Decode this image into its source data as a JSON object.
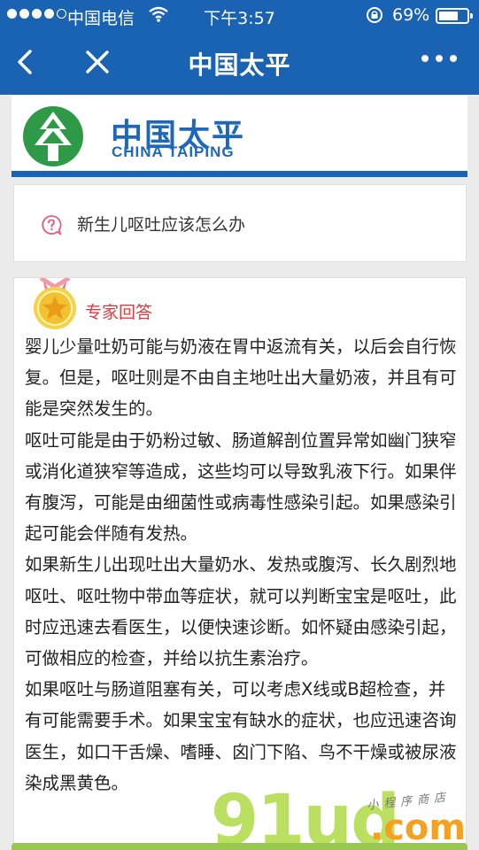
{
  "status_bar": {
    "carrier": "中国电信",
    "time": "下午3:57",
    "battery_percent": "69%",
    "battery_level": 0.69
  },
  "nav": {
    "title": "中国太平",
    "back_icon": "chevron-left-icon",
    "close_icon": "close-icon",
    "more_icon": "more-dots-icon"
  },
  "brand": {
    "name_cn": "中国太平",
    "name_en": "CHINA TAIPING",
    "color": "#1f68b8",
    "logo_green": "#2e9a47"
  },
  "question": {
    "icon": "question-bubble-icon",
    "text": "新生儿呕吐应该怎么办"
  },
  "answer": {
    "label": "专家回答",
    "badge_icon": "gold-medal-icon",
    "paragraphs": [
      "婴儿少量吐奶可能与奶液在胃中返流有关，以后会自行恢复。但是，呕吐则是不由自主地吐出大量奶液，并且有可能是突然发生的。",
      "呕吐可能是由于奶粉过敏、肠道解剖位置异常如幽门狭窄或消化道狭窄等造成，这些均可以导致乳液下行。如果伴有腹泻，可能是由细菌性或病毒性感染引起。如果感染引起可能会伴随有发热。",
      "如果新生儿出现吐出大量奶水、发热或腹泻、长久剧烈地呕吐、呕吐物中带血等症状，就可以判断宝宝是呕吐，此时应迅速去看医生，以便快速诊断。如怀疑由感染引起，可做相应的检查，并给以抗生素治疗。",
      "如果呕吐与肠道阻塞有关，可以考虑X线或B超检查，并有可能需要手术。如果宝宝有缺水的症状，也应迅速咨询医生，如口干舌燥、嗜睡、囟门下陷、鸟不干燥或被尿液染成黑黄色。"
    ]
  },
  "watermark": {
    "brand": "91ud",
    "domain": ".com",
    "tagline": "小程序商店"
  }
}
